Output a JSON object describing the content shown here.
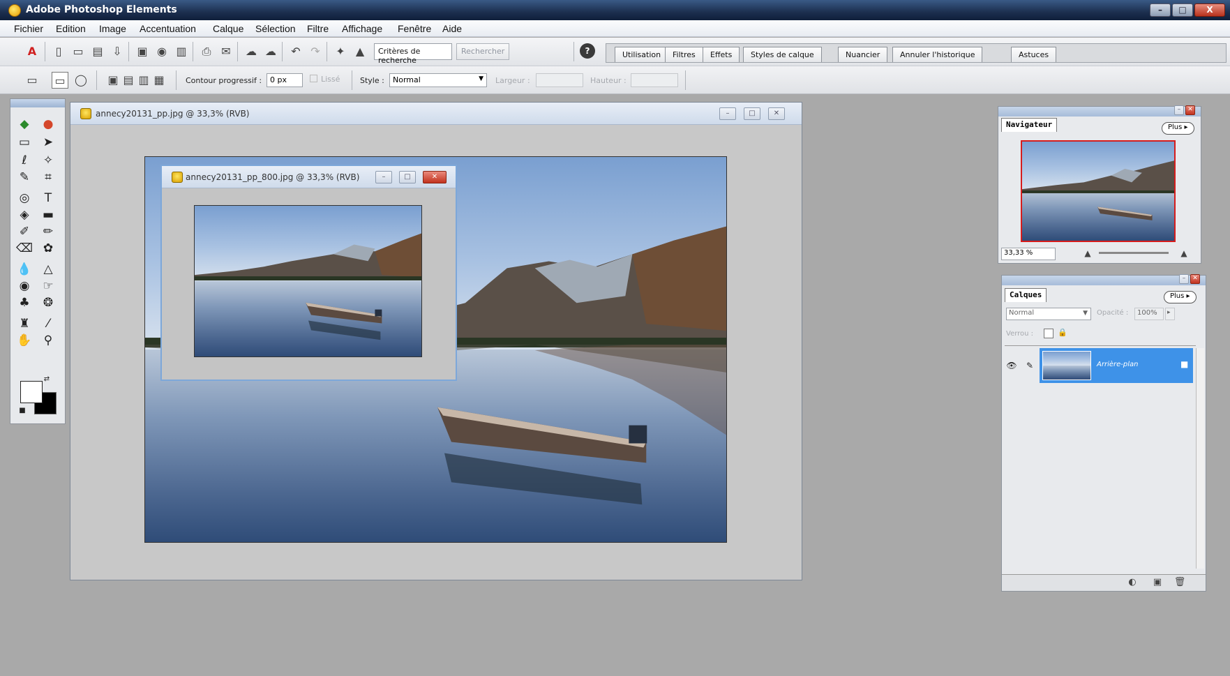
{
  "app": {
    "title": "Adobe Photoshop Elements"
  },
  "window_controls": {
    "minimize": "–",
    "maximize": "□",
    "close": "X"
  },
  "menu": [
    "Fichier",
    "Edition",
    "Image",
    "Accentuation",
    "Calque",
    "Sélection",
    "Filtre",
    "Affichage",
    "Fenêtre",
    "Aide"
  ],
  "toolbar": {
    "search_field": "Critères de recherche",
    "search_button": "Rechercher",
    "help": "?",
    "palette_tabs": [
      "Utilisation",
      "Filtres",
      "Effets",
      "Styles de calque",
      "Nuancier",
      "Annuler l'historique",
      "Astuces"
    ]
  },
  "options": {
    "feather_label": "Contour progressif :",
    "feather_value": "0 px",
    "antialias_label": "Lissé",
    "style_label": "Style :",
    "style_value": "Normal",
    "width_label": "Largeur :",
    "height_label": "Hauteur :"
  },
  "documents": {
    "main_title": "annecy20131_pp.jpg @ 33,3% (RVB)",
    "inner_title": "annecy20131_pp_800.jpg @ 33,3% (RVB)"
  },
  "navigator": {
    "tab": "Navigateur",
    "more": "Plus ▸",
    "zoom": "33,33 %"
  },
  "layers": {
    "tab": "Calques",
    "more": "Plus ▸",
    "blend_mode": "Normal",
    "opacity_label": "Opacité :",
    "opacity_value": "100%",
    "lock_label": "Verrou :",
    "layer_name": "Arrière-plan"
  }
}
